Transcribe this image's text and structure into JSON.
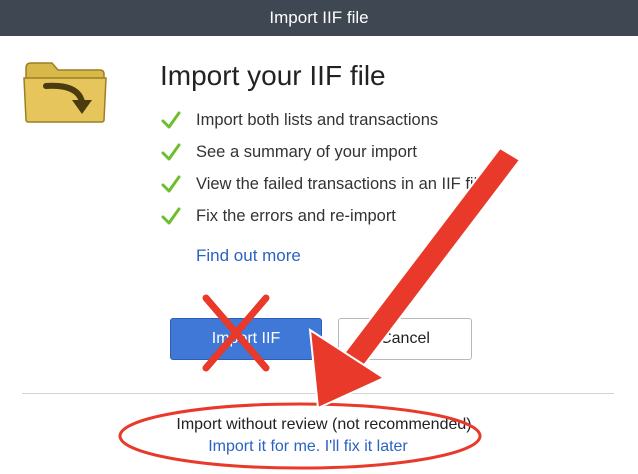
{
  "window": {
    "title": "Import IIF file"
  },
  "main": {
    "heading": "Import your IIF file",
    "features": [
      "Import both lists and transactions",
      "See a summary of your import",
      "View the failed transactions in an IIF file",
      "Fix the errors and re-import"
    ],
    "find_out_more": "Find out more"
  },
  "buttons": {
    "import_label": "Import IIF",
    "cancel_label": "Cancel"
  },
  "footer": {
    "note": "Import without review (not recommended)",
    "link": "Import it for me. I'll fix it later"
  },
  "colors": {
    "titlebar": "#3f4752",
    "link": "#2a63c4",
    "primary_button": "#3f78d6",
    "checkmark": "#6cbf2e",
    "annotation": "#e8392a"
  },
  "icons": {
    "folder": "folder-arrow-icon",
    "check": "checkmark-icon"
  }
}
